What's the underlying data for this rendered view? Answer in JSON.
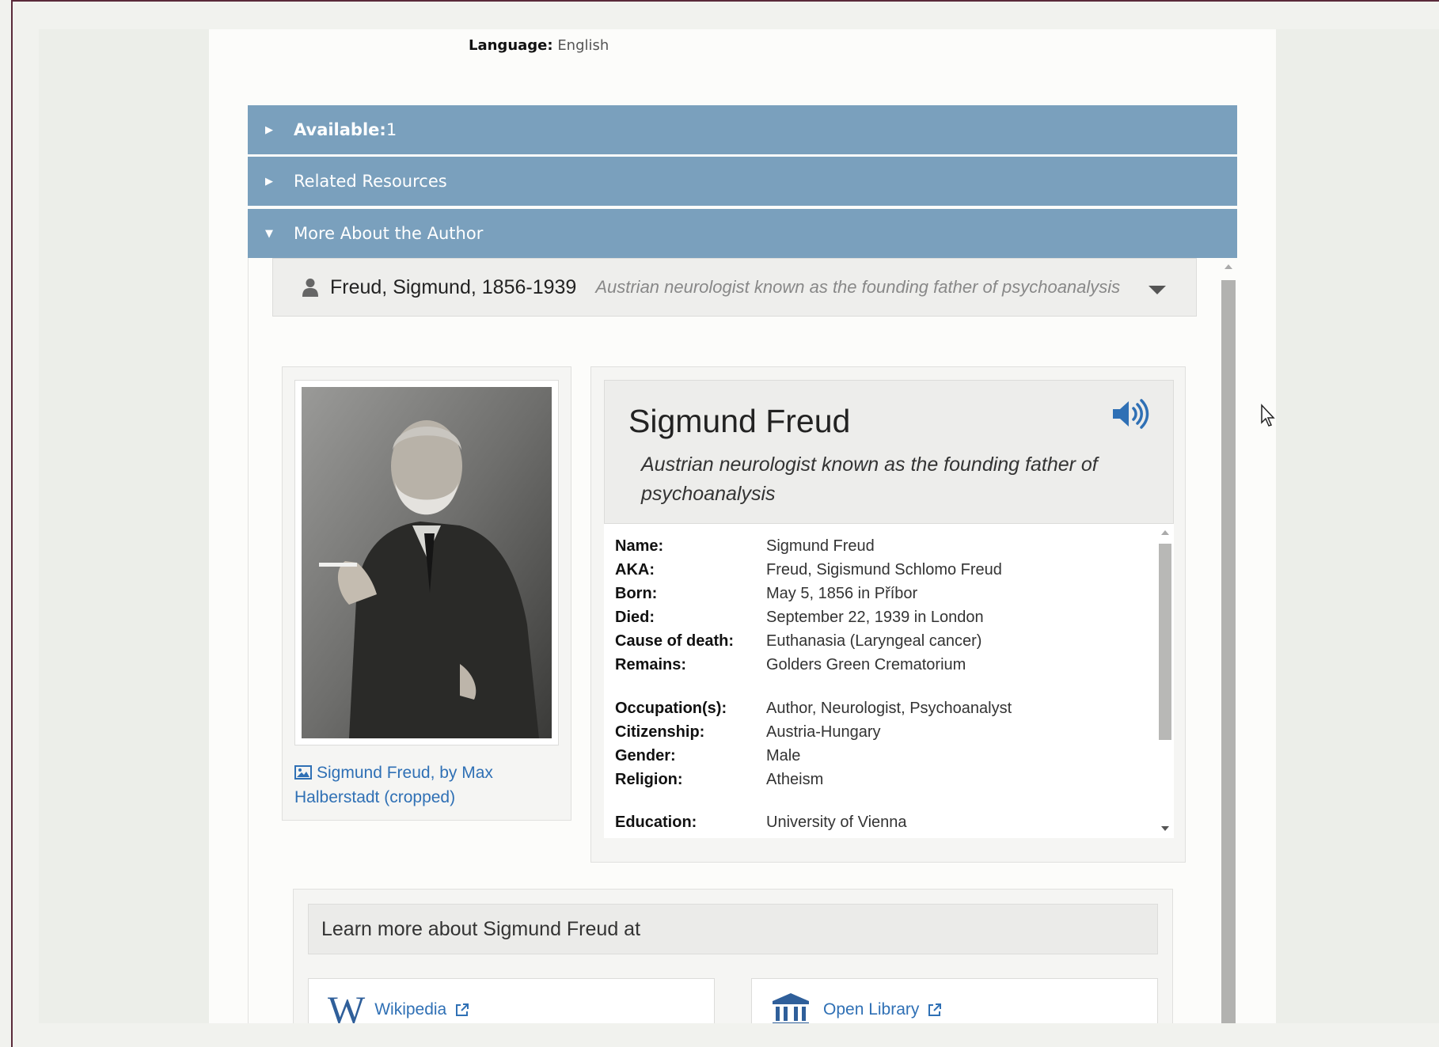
{
  "language": {
    "label": "Language:",
    "value": "English"
  },
  "accordion": [
    {
      "label": "Available:",
      "count": "1",
      "expanded": false
    },
    {
      "label": "Related Resources",
      "expanded": false
    },
    {
      "label": "More About the Author",
      "expanded": true
    }
  ],
  "author_bar": {
    "name": "Freud, Sigmund, 1856-1939",
    "description": "Austrian neurologist known as the founding father of psychoanalysis"
  },
  "photo": {
    "caption": "Sigmund Freud, by Max Halberstadt (cropped)"
  },
  "info": {
    "title": "Sigmund Freud",
    "subtitle": "Austrian neurologist known as the founding father of psychoanalysis",
    "facts": [
      {
        "label": "Name:",
        "value": "Sigmund Freud"
      },
      {
        "label": "AKA:",
        "value": "Freud, Sigismund Schlomo Freud"
      },
      {
        "label": "Born:",
        "value": "May 5, 1856 in Příbor"
      },
      {
        "label": "Died:",
        "value": "September 22, 1939 in London"
      },
      {
        "label": "Cause of death:",
        "value": "Euthanasia (Laryngeal cancer)"
      },
      {
        "label": "Remains:",
        "value": "Golders Green Crematorium"
      },
      {
        "label": "Occupation(s):",
        "value": "Author, Neurologist, Psychoanalyst"
      },
      {
        "label": "Citizenship:",
        "value": "Austria-Hungary"
      },
      {
        "label": "Gender:",
        "value": "Male"
      },
      {
        "label": "Religion:",
        "value": "Atheism"
      },
      {
        "label": "Education:",
        "value": "University of Vienna"
      }
    ]
  },
  "learn_more": {
    "heading": "Learn more about Sigmund Freud at",
    "links": [
      {
        "label": "Wikipedia",
        "icon": "wikipedia-icon"
      },
      {
        "label": "Open Library",
        "icon": "library-icon"
      }
    ]
  },
  "colors": {
    "accordion": "#7aa0bd",
    "link": "#2f70b5"
  }
}
